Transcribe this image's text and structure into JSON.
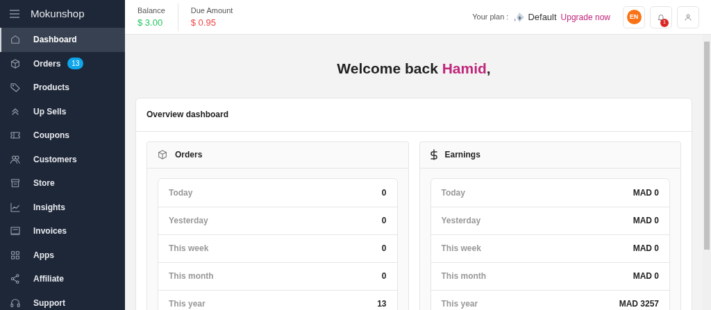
{
  "brand": "Mokunshop",
  "sidebar": {
    "items": [
      {
        "label": "Dashboard",
        "selected": true
      },
      {
        "label": "Orders",
        "selected": false,
        "badge": "13"
      },
      {
        "label": "Products",
        "selected": false
      },
      {
        "label": "Up Sells",
        "selected": false
      },
      {
        "label": "Coupons",
        "selected": false
      },
      {
        "label": "Customers",
        "selected": false
      },
      {
        "label": "Store",
        "selected": false
      },
      {
        "label": "Insights",
        "selected": false
      },
      {
        "label": "Invoices",
        "selected": false
      },
      {
        "label": "Apps",
        "selected": false
      },
      {
        "label": "Affiliate",
        "selected": false
      },
      {
        "label": "Support",
        "selected": false
      }
    ]
  },
  "header": {
    "stats": [
      {
        "label": "Balance",
        "value": "$ 3.00",
        "color": "#22c55e"
      },
      {
        "label": "Due Amount",
        "value": "$ 0.95",
        "color": "#ef4444"
      }
    ],
    "plan_label": "Your plan :",
    "plan_name": "Default",
    "upgrade_link": "Upgrade now",
    "language": "EN",
    "notification_count": "1"
  },
  "welcome": {
    "greeting": "Welcome back",
    "name": "Hamid",
    "punctuation": ","
  },
  "overview": {
    "title": "Overview dashboard",
    "panels": [
      {
        "kind": "orders",
        "title": "Orders",
        "rows": [
          {
            "label": "Today",
            "value": "0"
          },
          {
            "label": "Yesterday",
            "value": "0"
          },
          {
            "label": "This week",
            "value": "0"
          },
          {
            "label": "This month",
            "value": "0"
          },
          {
            "label": "This year",
            "value": "13"
          }
        ]
      },
      {
        "kind": "earnings",
        "title": "Earnings",
        "rows": [
          {
            "label": "Today",
            "value": "MAD 0"
          },
          {
            "label": "Yesterday",
            "value": "MAD 0"
          },
          {
            "label": "This week",
            "value": "MAD 0"
          },
          {
            "label": "This month",
            "value": "MAD 0"
          },
          {
            "label": "This year",
            "value": "MAD 3257"
          }
        ]
      }
    ]
  }
}
